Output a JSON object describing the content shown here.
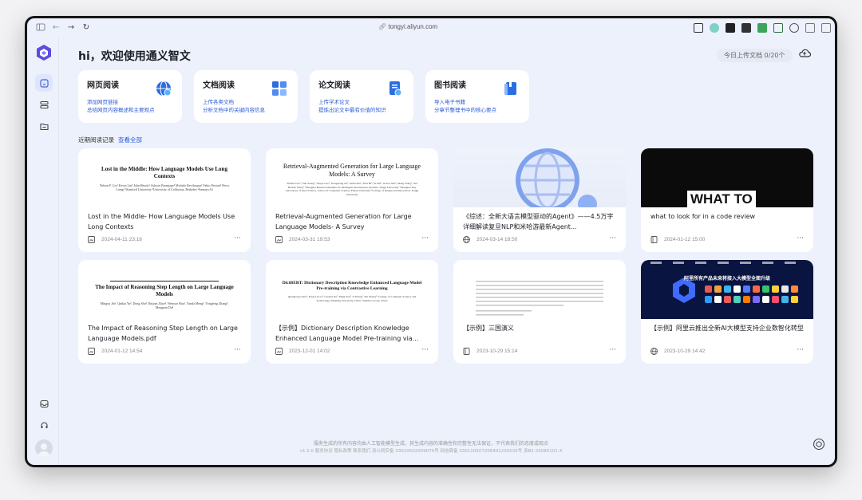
{
  "browser": {
    "url": "tongyi.aliyun.com"
  },
  "header": {
    "greeting": "hi，欢迎使用通义智文",
    "upload_count": "今日上传文档 0/20个"
  },
  "features": [
    {
      "title": "网页阅读",
      "desc1": "添加网页链接",
      "desc2": "总结网页内容概述和主要观点",
      "icon": "globe-icon"
    },
    {
      "title": "文档阅读",
      "desc1": "上传各类文档",
      "desc2": "分析文档中的关键内容信息",
      "icon": "document-grid-icon"
    },
    {
      "title": "论文阅读",
      "desc1": "上传学术论文",
      "desc2": "提炼出论文中最有价值的知识",
      "icon": "paper-icon"
    },
    {
      "title": "图书阅读",
      "desc1": "导入电子书籍",
      "desc2": "分章节整理书中的核心要点",
      "icon": "book-icon"
    }
  ],
  "recent": {
    "label": "近期阅读记录",
    "view_all": "查看全部"
  },
  "docs": [
    {
      "title": "Lost in the Middle- How Language Models Use Long Contexts",
      "date": "2024-04-11 23:18",
      "type": "document",
      "paper_title": "Lost in the Middle: How Language Models Use Long Contexts",
      "paper_authors": "Nelson F. Liu¹  Kevin Lin²  John Hewitt¹  Ashwin Paranjape³  Michele Bevilacqua³  Fabio Petroni³  Percy Liang¹  ¹Stanford University  ²University of California, Berkeley  ³Samaya AI"
    },
    {
      "title": "Retrieval-Augmented Generation for Large Language Models- A Survey",
      "date": "2024-03-31 19:53",
      "type": "document",
      "paper_title": "Retrieval-Augmented Generation for Large Language Models: A Survey",
      "paper_authors": "Yunfan Gao¹, Yun Xiong², Xinyu Gao², Kangxiang Jia², Jinliu Pan², Yuxi Bi³, Yi Dai¹, Jiawei Sun¹, Meng Wang³, and Haofen Wang¹ ¹Shanghai Research Institute for Intelligent Autonomous Systems, Tongji University ²Shanghai Key Laboratory of Data Science, School of Computer Science, Fudan University ³College of Design and Innovation, Tongji University"
    },
    {
      "title": "《综述：全新大语言模型驱动的Agent》——4.5万字详细解读复旦NLP和米哈游最新Agent...",
      "date": "2024-03-14 18:50",
      "type": "web"
    },
    {
      "title": "what to look for in a code review",
      "date": "2024-01-12 15:00",
      "type": "book",
      "banner": "WHAT TO"
    },
    {
      "title": "The Impact of Reasoning Step Length on Large Language Models.pdf",
      "date": "2024-01-12 14:54",
      "type": "document",
      "paper_title": "The Impact of Reasoning Step Length on Large Language Models",
      "paper_authors": "Mingyu Jin¹, Qinkai Yu², Dong Shu³, Haiyan Zhao⁴, Wenyue Hua⁵, Yanda Meng², Yongfeng Zhang⁵, Mengnan Du⁴"
    },
    {
      "title": "【示例】Dictionary Description Knowledge Enhanced Language Model Pre-training via...",
      "date": "2023-12-01 14:02",
      "type": "document",
      "paper_title": "DictBERT: Dictionary Description Knowledge Enhanced Language Model Pre-training via Contrastive Learning",
      "paper_authors": "Qianglong Chen¹, Feng-Lin Li², Guohai Xu², Ming Yan², Ji Zhang², Yin Zhang¹ ¹College of Computer Science and Technology, Zhejiang University, China ²Alibaba Group, China"
    },
    {
      "title": "【示例】三国演义",
      "date": "2023-10-29 15:14",
      "type": "book"
    },
    {
      "title": "【示例】阿里云推出全新AI大模型支持企业数智化转型",
      "date": "2023-10-29 14:42",
      "type": "web",
      "banner": "阿里所有产品未来将接入大模型全面升级"
    }
  ],
  "footer": {
    "line1": "服务生成的所有内容均由人工智能模型生成，其生成内容的准确性和完整性无法保证，不代表我们的态度或观点",
    "line2": "v1.0.0  服务协议  隐私政策  联系我们  浙公网安备 33010502009075号  网信算备 330110507206401230035号  浙B2-20080101-4"
  },
  "colors": {
    "accent": "#2c5bd6",
    "background": "#edf1fb"
  }
}
